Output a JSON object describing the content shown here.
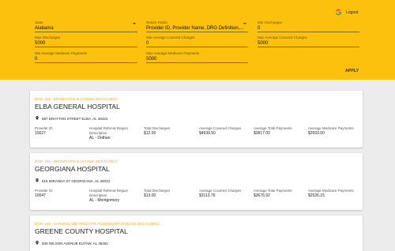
{
  "header": {
    "logout_label": "Logout",
    "apply_label": "APPLY",
    "filters": {
      "state": {
        "label": "State",
        "value": "Alabama"
      },
      "return_fields": {
        "label": "Return Fields",
        "value": "Provider ID, Provider Name, DRG Definition,..."
      },
      "min_discharges": {
        "label": "Min Discharges",
        "value": "0"
      },
      "max_discharges": {
        "label": "Max Discharges",
        "value": "5000"
      },
      "min_avg_covered": {
        "label": "Min Average Covered Charges",
        "value": "0"
      },
      "max_avg_covered": {
        "label": "Max Average Covered Charges",
        "value": "5000"
      },
      "min_avg_medicare": {
        "label": "Min Average Medicare Payments",
        "value": "0"
      },
      "max_avg_medicare": {
        "label": "Max Average Medicare Payments",
        "value": "5000"
      }
    }
  },
  "columns": {
    "provider_id": "Provider ID",
    "region": "Hospital Referral Region Description",
    "discharges": "Total Discharges",
    "covered": "Average Covered Charges",
    "total_payments": "Average Total Payments",
    "medicare": "Average Medicare Payments"
  },
  "hospitals": [
    {
      "drg": "DGR: 202 - BRONCHITIS & ASTHMA W/O CC/MCC",
      "name": "ELBA GENERAL HOSPITAL",
      "address": "987 DRAYTON STREET ELBA, AL 36323",
      "provider_id": "10027",
      "region": "AL - Dothan",
      "discharges": "$12.00",
      "covered": "$4939.50",
      "total_payments": "$3817.00",
      "medicare": "$2693.00"
    },
    {
      "drg": "DGR: 202 - BRONCHITIS & ASTHMA W/O CC/MCC",
      "name": "GEORGIANA HOSPITAL",
      "address": "515 MIRANDA ST GEORGIANA, AL 36033",
      "provider_id": "10047",
      "region": "AL - Montgomery",
      "discharges": "$13.00",
      "covered": "$3113.76",
      "total_payments": "$3676.92",
      "medicare": "$2526.15"
    },
    {
      "drg": "DGR: 192 - CHRONIC OBSTRUCTIVE PULMONARY DISEASE W/O CC/MCC",
      "name": "GREENE COUNTY HOSPITAL",
      "address": "509 WILSON AVENUE EUTAW, AL 35462"
    }
  ]
}
